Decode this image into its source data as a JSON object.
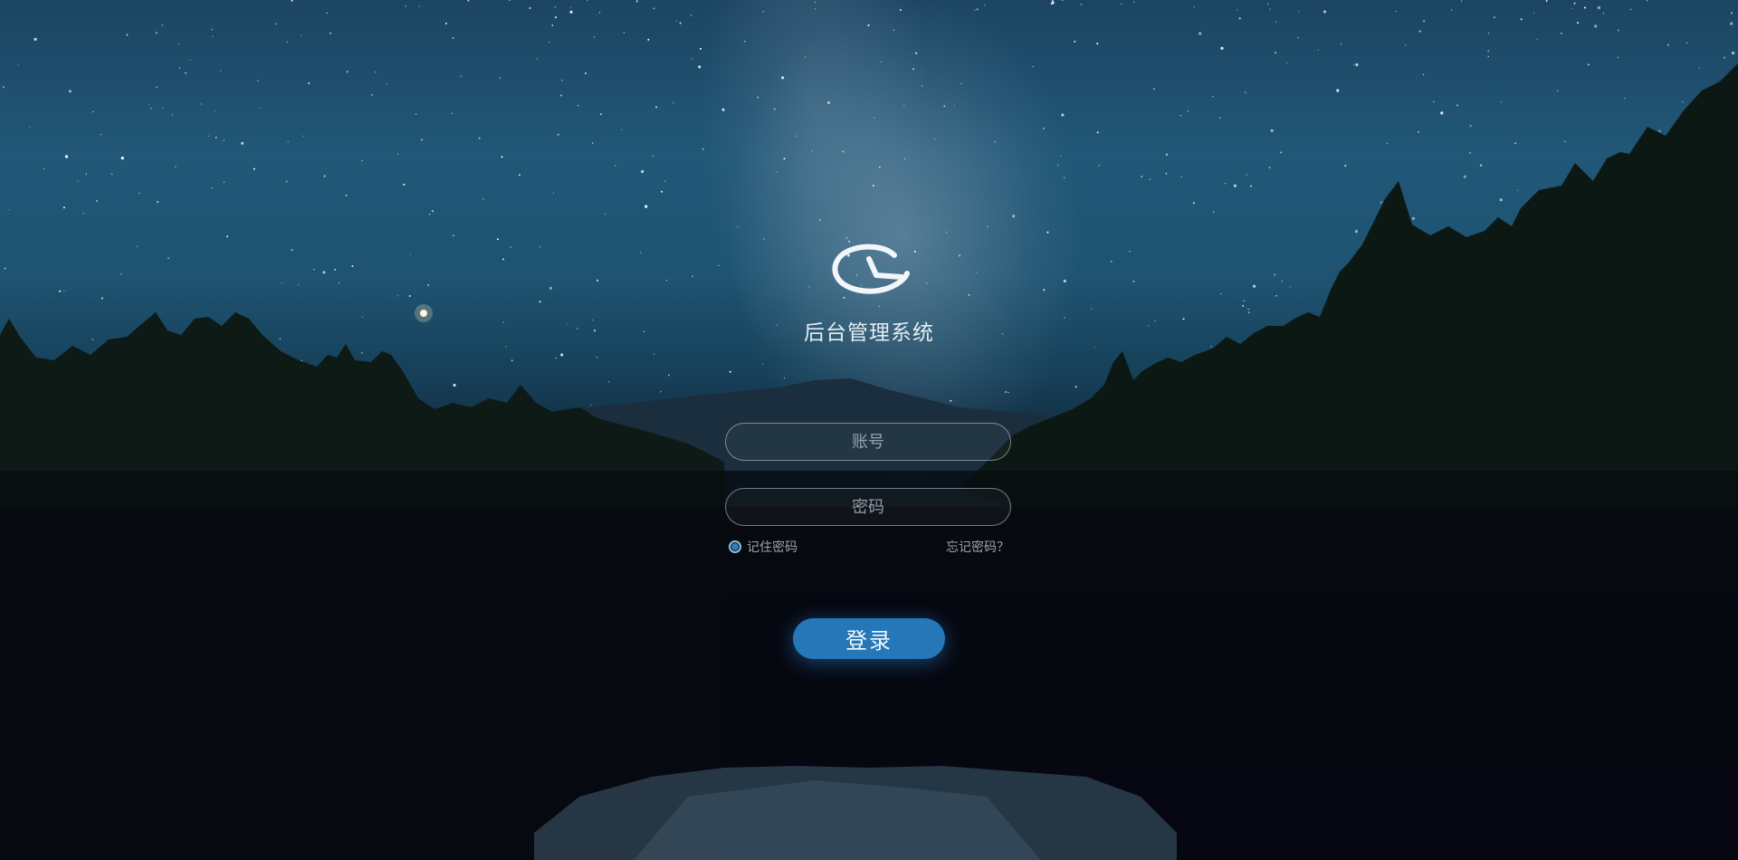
{
  "app": {
    "title": "后台管理系统",
    "logo_icon": "clock-swirl-icon"
  },
  "form": {
    "account_placeholder": "账号",
    "password_placeholder": "密码",
    "remember_label": "记住密码",
    "remember_checked": true,
    "forgot_label": "忘记密码？",
    "login_label": "登录"
  },
  "colors": {
    "accent": "#2577b8",
    "sky_top": "#1c4563",
    "sky_mid": "#215777",
    "ground": "#070a12"
  },
  "background": {
    "scene": "night sky with milky way over forest, mountain and lake"
  }
}
